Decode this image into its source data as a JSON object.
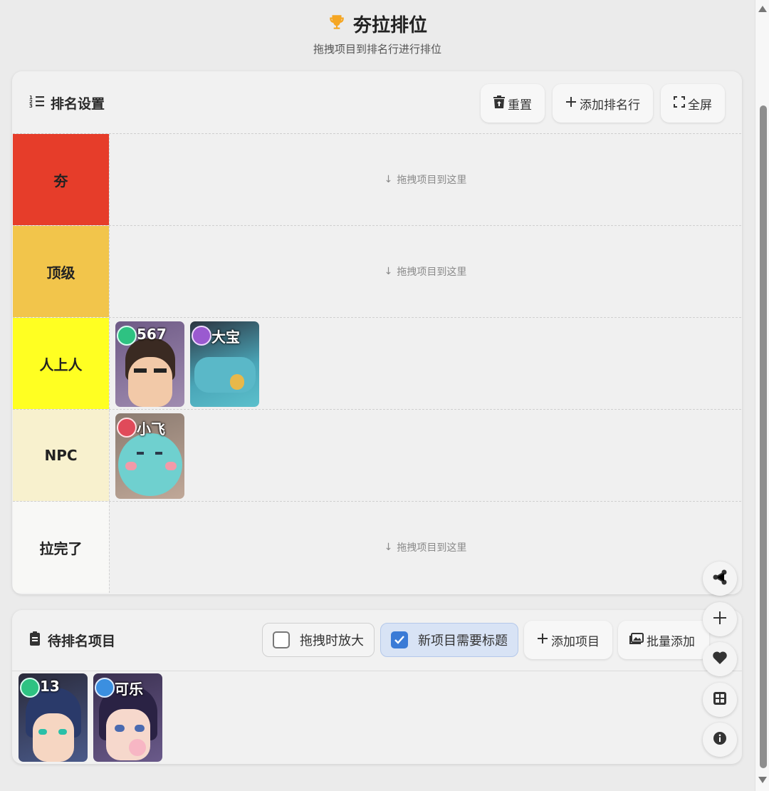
{
  "header": {
    "icon": "trophy-icon",
    "title": "夯拉排位",
    "subtitle": "拖拽项目到排名行进行排位"
  },
  "settings": {
    "title": "排名设置",
    "icon": "list-numbered-icon",
    "reset_label": "重置",
    "add_tier_label": "添加排名行",
    "fullscreen_label": "全屏"
  },
  "drop_hint": "拖拽项目到这里",
  "tiers": [
    {
      "label": "夯",
      "color": "#e63d2a",
      "items": []
    },
    {
      "label": "顶级",
      "color": "#f2c54b",
      "items": []
    },
    {
      "label": "人上人",
      "color": "#ffff22",
      "items": [
        {
          "name": "567",
          "badge_color": "#2ec282",
          "bg": "#8a7896"
        },
        {
          "name": "大宝",
          "badge_color": "#9a5ad0",
          "bg": "#4aa6b8"
        }
      ]
    },
    {
      "label": "NPC",
      "color": "#f8f1ce",
      "items": [
        {
          "name": "小飞",
          "badge_color": "#e04a5a",
          "bg": "#6fd0cf"
        }
      ]
    },
    {
      "label": "拉完了",
      "color": "#f8f8f6",
      "items": []
    }
  ],
  "pool": {
    "title": "待排名项目",
    "icon": "clipboard-icon",
    "zoom_on_drag_label": "拖拽时放大",
    "zoom_on_drag_checked": false,
    "require_title_label": "新项目需要标题",
    "require_title_checked": true,
    "add_item_label": "添加项目",
    "batch_add_label": "批量添加",
    "items": [
      {
        "name": "13",
        "badge_color": "#2ec282",
        "bg": "#3a4a7c"
      },
      {
        "name": "可乐",
        "badge_color": "#3b8fe0",
        "bg": "#5a4a7a"
      }
    ]
  },
  "fabs": [
    "share-icon",
    "plus-icon",
    "heart-icon",
    "grid-icon",
    "info-icon"
  ]
}
